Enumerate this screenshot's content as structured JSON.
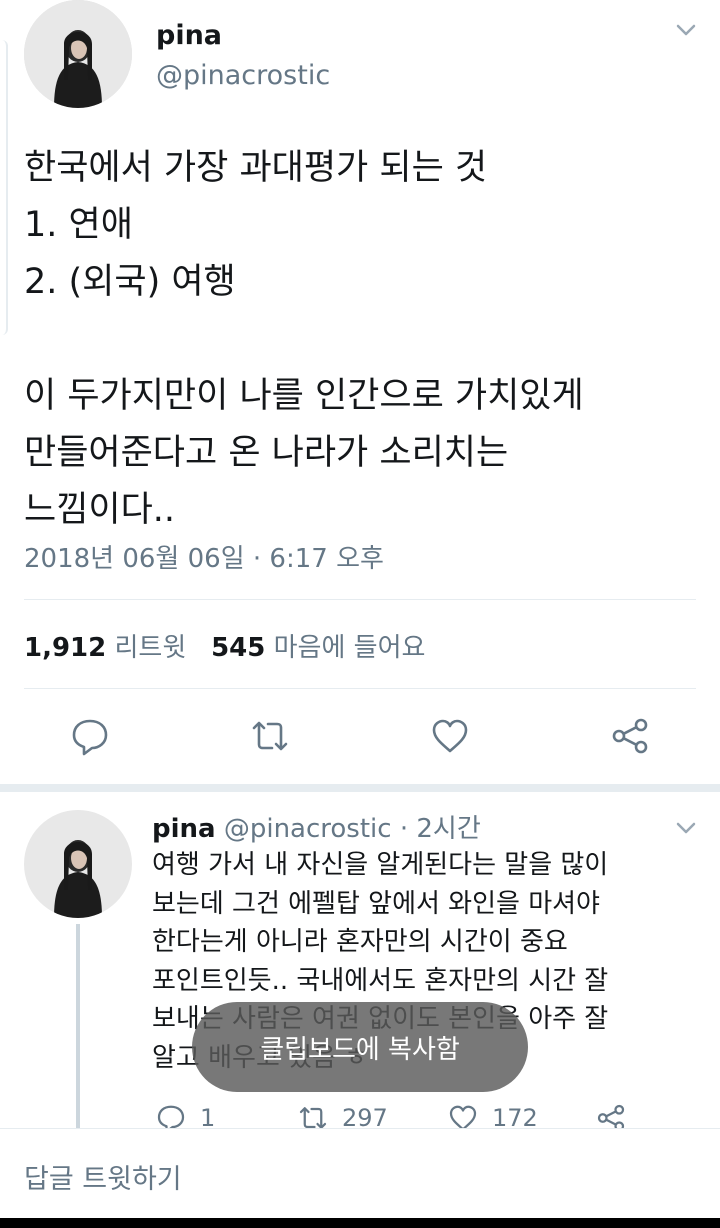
{
  "tweet": {
    "display_name": "pina",
    "handle": "@pinacrostic",
    "text": "한국에서 가장 과대평가 되는 것\n1. 연애\n2. (외국) 여행\n\n이 두가지만이 나를 인간으로 가치있게\n만들어준다고 온 나라가 소리치는\n느낌이다..",
    "timestamp": "2018년 06월 06일 · 6:17 오후",
    "retweet_count": "1,912",
    "retweet_label": "리트윗",
    "like_count": "545",
    "like_label": "마음에 들어요"
  },
  "reply": {
    "display_name": "pina",
    "meta": "@pinacrostic · 2시간",
    "text": "여행 가서 내 자신을 알게된다는 말을 많이\n보는데 그건 에펠탑 앞에서 와인을 마셔야\n한다는게 아니라 혼자만의 시간이 중요\n포인트인듯.. 국내에서도 혼자만의 시간 잘\n보내는 사람은 여권 없이도 본인을 아주 잘\n알고 배우고 있음 ㅎ",
    "reply_count": "1",
    "retweet_count": "297",
    "like_count": "172"
  },
  "toast": {
    "message": "클립보드에 복사함"
  },
  "compose": {
    "placeholder": "답글 트윗하기"
  },
  "colors": {
    "text": "#14171a",
    "secondary": "#657786",
    "divider": "#e6ecf0",
    "thread_line": "#ccd6dd"
  },
  "icons": [
    "chevron-down-icon",
    "reply-icon",
    "retweet-icon",
    "like-icon",
    "share-icon"
  ]
}
